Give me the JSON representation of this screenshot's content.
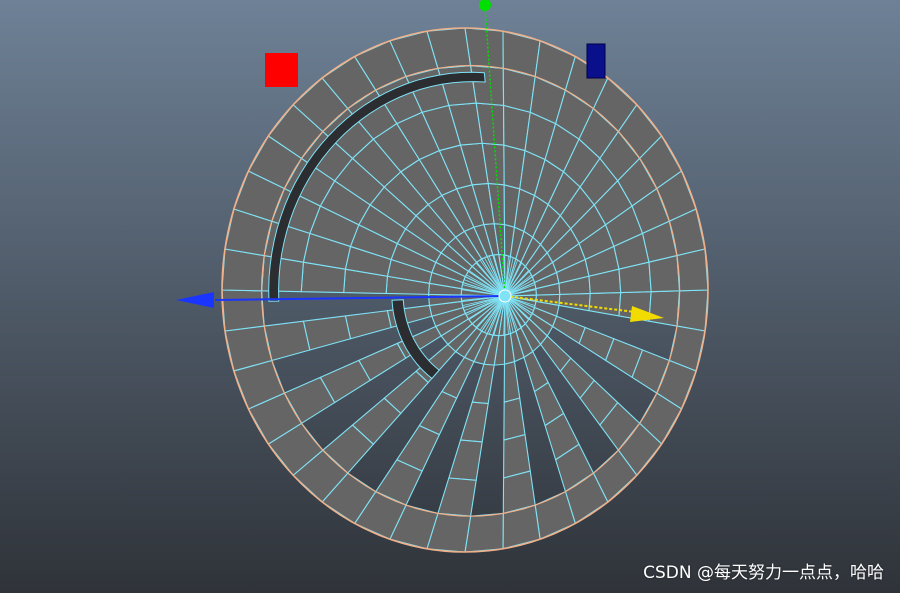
{
  "viewport": {
    "background_top": "#6e8196",
    "background_bottom": "#2f3339",
    "face_color": "#656565",
    "hole_color": "#3d4249",
    "wire_color": "#7fe2f5",
    "border_color": "#f0b08a",
    "dark_strip_color": "#2b2d30"
  },
  "gizmo": {
    "x_axis_color": "#f2dc00",
    "y_axis_color": "#00e000",
    "z_axis_color": "#1a35ff",
    "center_color": "#7fe2f5"
  },
  "handles": {
    "red_handle_color": "#ff0000",
    "blue_handle_color": "#0a0f8c"
  },
  "watermark": "CSDN @每天努力一点点，哈哈"
}
